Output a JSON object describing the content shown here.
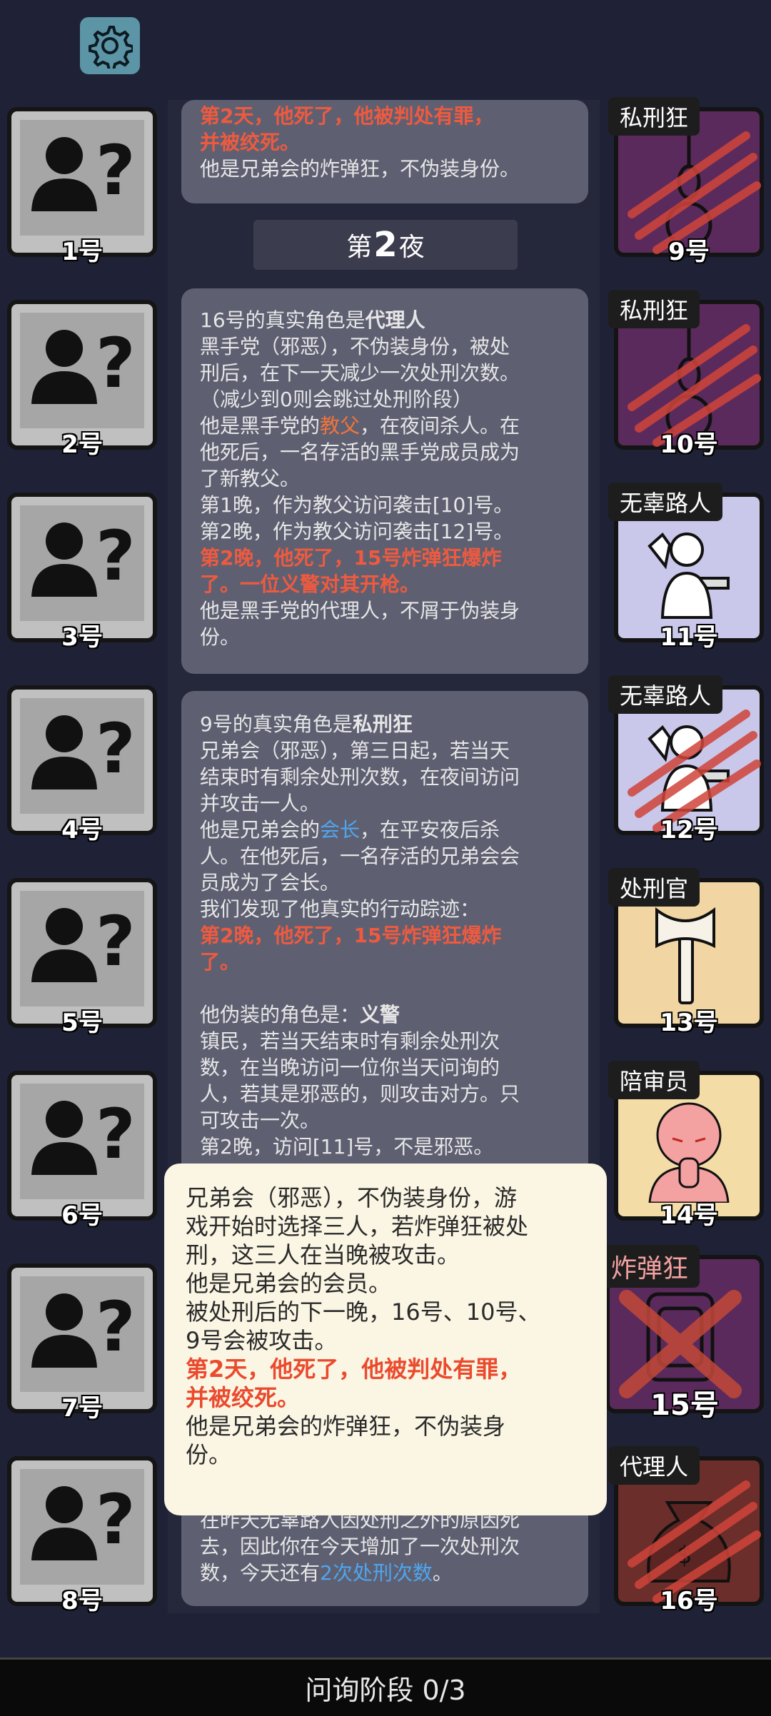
{
  "players": [
    {
      "num": "1号"
    },
    {
      "num": "2号"
    },
    {
      "num": "3号"
    },
    {
      "num": "4号"
    },
    {
      "num": "5号"
    },
    {
      "num": "6号"
    },
    {
      "num": "7号"
    },
    {
      "num": "8号"
    }
  ],
  "roles": [
    {
      "tag": "私刑狂",
      "num": "9号",
      "color": "#5a2a5c",
      "icon": "noose-icon",
      "scratched": true
    },
    {
      "tag": "私刑狂",
      "num": "10号",
      "color": "#5a2a5c",
      "icon": "noose-icon",
      "scratched": true
    },
    {
      "tag": "无辜路人",
      "num": "11号",
      "color": "#c9c7ea",
      "icon": "hostage-icon",
      "scratched": false
    },
    {
      "tag": "无辜路人",
      "num": "12号",
      "color": "#c9c7ea",
      "icon": "hostage-icon",
      "scratched": true
    },
    {
      "tag": "处刑官",
      "num": "13号",
      "color": "#f1d6a3",
      "icon": "axe-icon",
      "scratched": false
    },
    {
      "tag": "陪审员",
      "num": "14号",
      "color": "#f3dca6",
      "icon": "praying-person-icon",
      "scratched": false
    },
    {
      "tag": "炸弹狂",
      "num": "15号",
      "color": "#5a2a5c",
      "icon": "bomb-icon",
      "scratched": true
    },
    {
      "tag": "代理人",
      "num": "16号",
      "color": "#6b2e2a",
      "icon": "money-bag-icon",
      "scratched": true
    }
  ],
  "log": {
    "top_card": {
      "line1": "第2天，他死了，他被判处有罪，",
      "line2": "并被绞死。",
      "line3": "他是兄弟会的炸弹狂，不伪装身份。"
    },
    "night": {
      "prefix": "第",
      "number": "2",
      "suffix": "夜"
    },
    "card1": {
      "head_prefix": "16号的真实角色是",
      "head_role": "代理人",
      "l1": "黑手党（邪恶），不伪装身份，被处",
      "l2": "刑后，在下一天减少一次处刑次数。",
      "l3": "（减少到0则会跳过处刑阶段）",
      "l4a": "他是黑手党的",
      "l4b": "教父",
      "l4c": "，在夜间杀人。在",
      "l5": "他死后，一名存活的黑手党成员成为",
      "l6": "了新教父。",
      "l7": "第1晚，作为教父访问袭击[10]号。",
      "l8": "第2晚，作为教父访问袭击[12]号。",
      "l9": "第2晚，他死了，15号炸弹狂爆炸",
      "l10": "了。一位义警对其开枪。",
      "l11": "他是黑手党的代理人，不屑于伪装身",
      "l12": "份。"
    },
    "card2": {
      "head_prefix": "9号的真实角色是",
      "head_role": "私刑狂",
      "l1": "兄弟会（邪恶），第三日起，若当天",
      "l2": "结束时有剩余处刑次数，在夜间访问",
      "l3": "并攻击一人。",
      "l4a": "他是兄弟会的",
      "l4b": "会长",
      "l4c": "，在平安夜后杀",
      "l5": "人。在他死后，一名存活的兄弟会会",
      "l6": "员成为了会长。",
      "l7": "我们发现了他真实的行动踪迹：",
      "l8": "第2晚，他死了，15号炸弹狂爆炸",
      "l9": "了。",
      "l10a": "他伪装的角色是：",
      "l10b": "义警",
      "l11": "镇民，若当天结束时有剩余处刑次",
      "l12": "数，在当晚访问一位你当天问询的",
      "l13": "人，若其是邪恶的，则攻击对方。只",
      "l14": "可攻击一次。",
      "l15": "第2晚，访问[11]号，不是邪恶。",
      "l16": "在昨天无辜路人因处刑之外的原因死",
      "l17": "去，因此你在今天增加了一次处刑次",
      "l18a": "数，今天还有",
      "l18b": "2次处刑次数",
      "l18c": "。"
    }
  },
  "popup": {
    "l1": "兄弟会（邪恶），不伪装身份，游",
    "l2": "戏开始时选择三人，若炸弹狂被处",
    "l3": "刑，这三人在当晚被攻击。",
    "l4": "他是兄弟会的会员。",
    "l5": "被处刑后的下一晚，16号、10号、",
    "l6": "9号会被攻击。",
    "l7": "第2天，他死了，他被判处有罪，",
    "l8": "并被绞死。",
    "l9": "他是兄弟会的炸弹狂，不伪装身",
    "l10": "份。"
  },
  "bottom_bar": {
    "label": "问询阶段 0/3"
  }
}
